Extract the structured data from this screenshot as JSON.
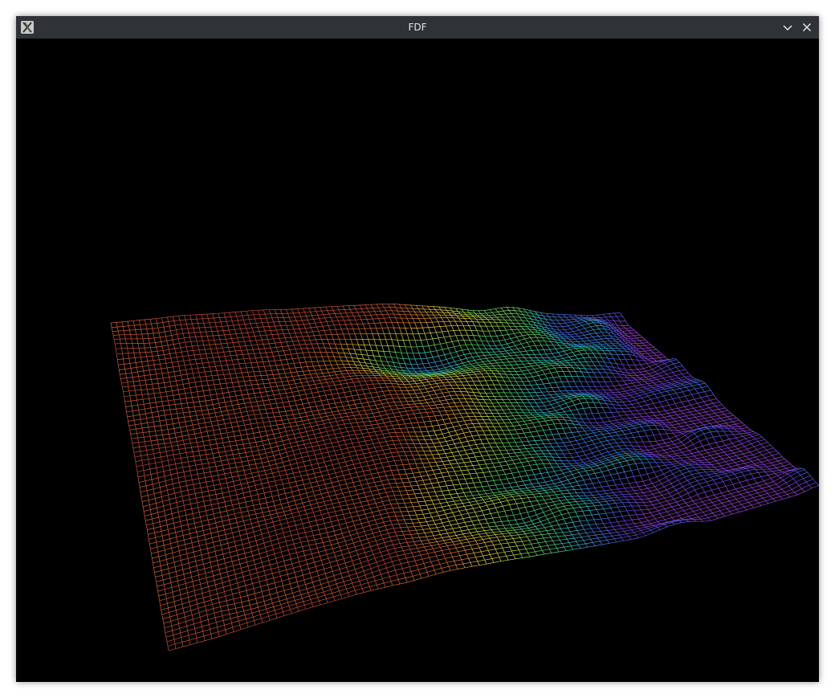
{
  "window": {
    "title": "FDF",
    "app_icon": "x11-app-icon",
    "controls": [
      "minimize-icon",
      "close-icon"
    ]
  },
  "render": {
    "background": "#000000",
    "style": "isometric wireframe heightmap",
    "color_ramp": [
      "#c0443a",
      "#d96a2e",
      "#e8c640",
      "#b6e04a",
      "#4fd36a",
      "#33c8c8",
      "#3a78e8",
      "#6a44e0",
      "#a040e0"
    ]
  }
}
